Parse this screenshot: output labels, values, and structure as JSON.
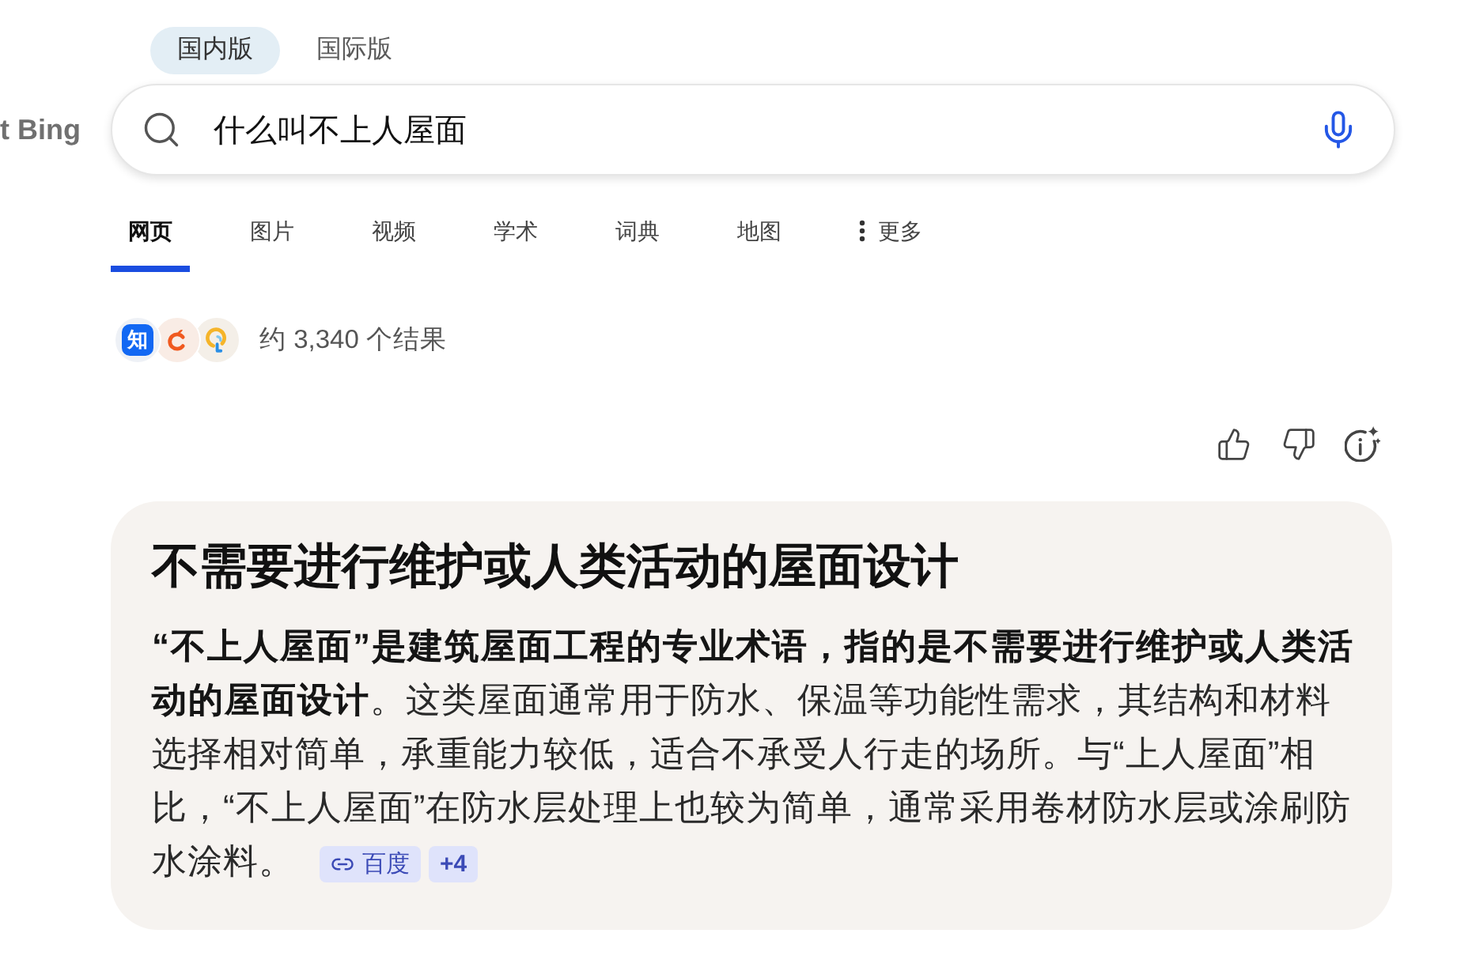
{
  "brand_fragment": "t Bing",
  "edition_tabs": [
    {
      "label": "国内版",
      "selected": true
    },
    {
      "label": "国际版",
      "selected": false
    }
  ],
  "search": {
    "value": "什么叫不上人屋面"
  },
  "nav_tabs": [
    {
      "label": "网页",
      "kind": "tab",
      "selected": true
    },
    {
      "label": "图片",
      "kind": "tab",
      "selected": false
    },
    {
      "label": "视频",
      "kind": "tab",
      "selected": false
    },
    {
      "label": "学术",
      "kind": "tab",
      "selected": false
    },
    {
      "label": "词典",
      "kind": "tab",
      "selected": false
    },
    {
      "label": "地图",
      "kind": "tab",
      "selected": false
    },
    {
      "label": "更多",
      "kind": "more",
      "selected": false
    }
  ],
  "results": {
    "sources": [
      {
        "kind": "glyph",
        "glyph": "知"
      },
      {
        "kind": "ring"
      },
      {
        "kind": "bulb"
      }
    ],
    "count": "约 3,340 个结果"
  },
  "answer": {
    "title": "不需要进行维护或人类活动的屋面设计",
    "text": "**“不上人屋面”是建筑屋面工程的专业术语，指的是不需要进行维护或人类活动的屋面设计**。这类屋面通常用于防水、保温等功能性需求，其结构和材料选择相对简单，承重能力较低，适合不承受人行走的场所。与“上人屋面”相比，“不上人屋面”在防水层处理上也较为简单，通常采用卷材防水层或涂刷防水涂料。",
    "citations": [
      {
        "kind": "source",
        "label": "百度"
      },
      {
        "kind": "more",
        "label": "+4"
      }
    ]
  }
}
